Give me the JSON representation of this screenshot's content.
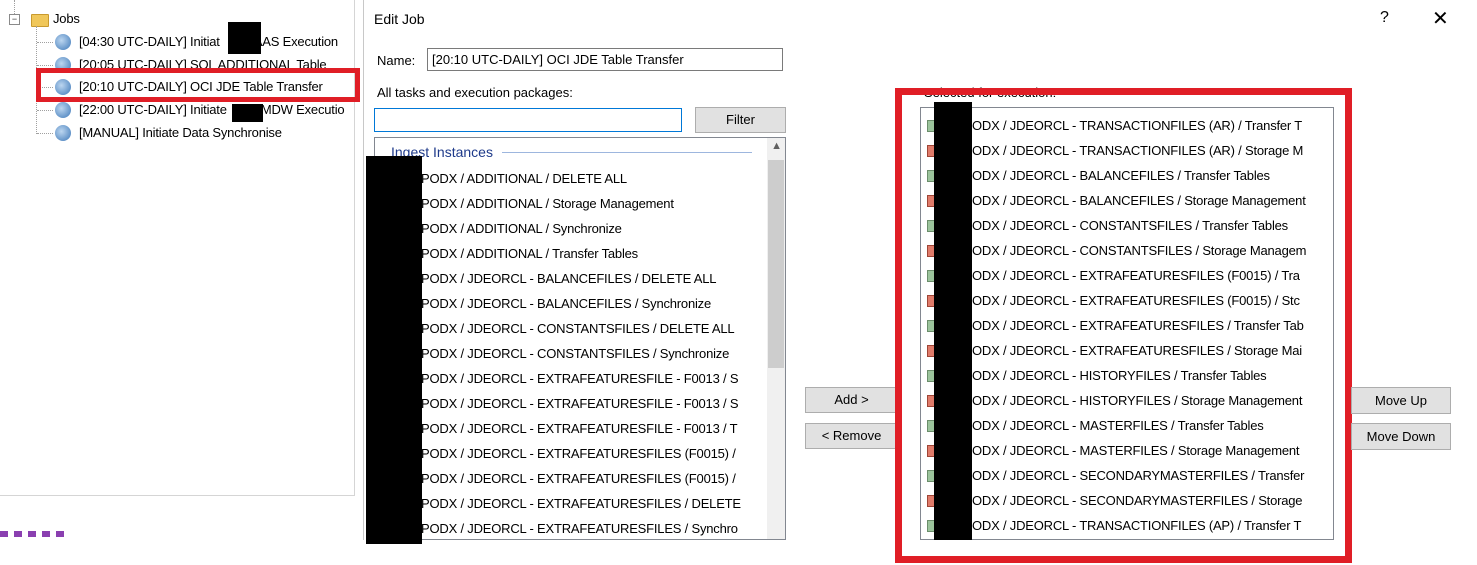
{
  "tree": {
    "jobs_label": "Jobs",
    "items": [
      {
        "label": "[04:30 UTC-DAILY] Initiat          AAS Execution"
      },
      {
        "label": "[20:05 UTC-DAILY] SQL ADDITIONAL Table"
      },
      {
        "label": "[20:10 UTC-DAILY] OCI JDE Table Transfer"
      },
      {
        "label": "[22:00 UTC-DAILY] Initiate          MDW Executio"
      },
      {
        "label": "[MANUAL] Initiate Data Synchronise"
      }
    ]
  },
  "dialog": {
    "title": "Edit Job",
    "help": "?",
    "close": "✕",
    "name_label": "Name:",
    "name_value": "[20:10 UTC-DAILY] OCI JDE Table Transfer",
    "all_label": "All tasks and execution packages:",
    "filter_value": "",
    "filter_button": "Filter",
    "group_header": "Ingest Instances",
    "left_items": [
      "PODX / ADDITIONAL / DELETE ALL",
      "PODX / ADDITIONAL / Storage Management",
      "PODX / ADDITIONAL / Synchronize",
      "PODX / ADDITIONAL / Transfer Tables",
      "PODX / JDEORCL - BALANCEFILES / DELETE ALL",
      "PODX / JDEORCL - BALANCEFILES / Synchronize",
      "PODX / JDEORCL - CONSTANTSFILES / DELETE ALL",
      "PODX / JDEORCL - CONSTANTSFILES / Synchronize",
      "PODX / JDEORCL - EXTRAFEATURESFILE - F0013 / S",
      "PODX / JDEORCL - EXTRAFEATURESFILE - F0013 / S",
      "PODX / JDEORCL - EXTRAFEATURESFILE - F0013 / T",
      "PODX / JDEORCL - EXTRAFEATURESFILES (F0015) /",
      "PODX / JDEORCL - EXTRAFEATURESFILES (F0015) /",
      "PODX / JDEORCL - EXTRAFEATURESFILES / DELETE",
      "PODX / JDEORCL - EXTRAFEATURESFILES / Synchro"
    ],
    "add_button": "Add >",
    "remove_button": "< Remove",
    "selected_label": "Selected for execution:",
    "right_items": [
      {
        "text": "ODX / JDEORCL - TRANSACTIONFILES (AR) / Transfer T",
        "kind": "transfer"
      },
      {
        "text": "ODX / JDEORCL - TRANSACTIONFILES (AR) / Storage M",
        "kind": "storage"
      },
      {
        "text": "ODX / JDEORCL - BALANCEFILES / Transfer Tables",
        "kind": "transfer"
      },
      {
        "text": "ODX / JDEORCL - BALANCEFILES / Storage Management",
        "kind": "storage"
      },
      {
        "text": "ODX / JDEORCL - CONSTANTSFILES / Transfer Tables",
        "kind": "transfer"
      },
      {
        "text": "ODX / JDEORCL - CONSTANTSFILES / Storage Managem",
        "kind": "storage"
      },
      {
        "text": "ODX / JDEORCL - EXTRAFEATURESFILES (F0015) / Tra",
        "kind": "transfer"
      },
      {
        "text": "ODX / JDEORCL - EXTRAFEATURESFILES (F0015) / Stc",
        "kind": "storage"
      },
      {
        "text": "ODX / JDEORCL - EXTRAFEATURESFILES / Transfer Tab",
        "kind": "transfer"
      },
      {
        "text": "ODX / JDEORCL - EXTRAFEATURESFILES / Storage Mai",
        "kind": "storage"
      },
      {
        "text": "ODX / JDEORCL - HISTORYFILES / Transfer Tables",
        "kind": "transfer"
      },
      {
        "text": "ODX / JDEORCL - HISTORYFILES / Storage Management",
        "kind": "storage"
      },
      {
        "text": "ODX / JDEORCL - MASTERFILES / Transfer Tables",
        "kind": "transfer"
      },
      {
        "text": "ODX / JDEORCL - MASTERFILES / Storage Management",
        "kind": "storage"
      },
      {
        "text": "ODX / JDEORCL - SECONDARYMASTERFILES / Transfer",
        "kind": "transfer"
      },
      {
        "text": "ODX / JDEORCL - SECONDARYMASTERFILES / Storage",
        "kind": "storage"
      },
      {
        "text": "ODX / JDEORCL - TRANSACTIONFILES (AP) / Transfer T",
        "kind": "transfer"
      }
    ],
    "move_up_button": "Move Up",
    "move_down_button": "Move Down"
  },
  "colors": {
    "highlight_red": "#e01e26",
    "group_header_blue": "#1e3a8a"
  }
}
